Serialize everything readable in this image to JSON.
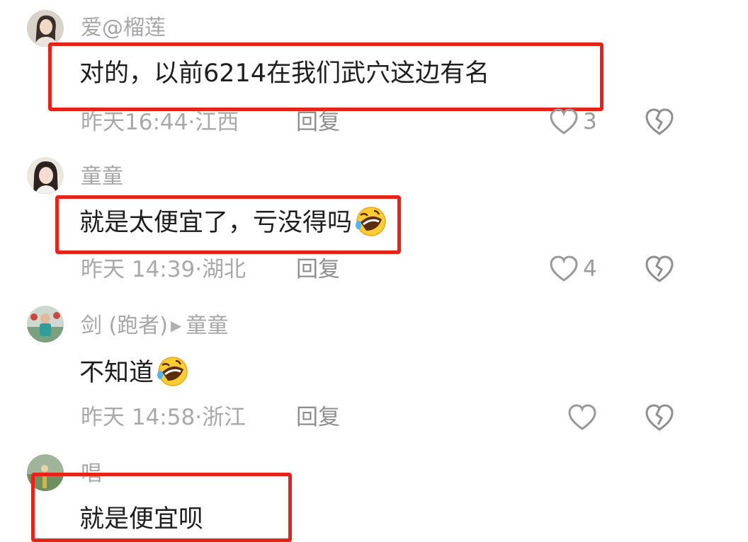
{
  "comments": [
    {
      "username": "爱@榴莲",
      "text": "对的，以前6214在我们武穴这边有名",
      "time": "昨天16:44",
      "location": "江西",
      "reply_label": "回复",
      "likes": "3",
      "avatar_icon": "user-avatar-photo"
    },
    {
      "username": "童童",
      "text": "就是太便宜了，亏没得吗",
      "emoji": "rolling-laughing-emoji",
      "time": "昨天 14:39",
      "location": "湖北",
      "reply_label": "回复",
      "likes": "4",
      "avatar_icon": "user-avatar-photo"
    },
    {
      "username": "剑 (跑者)",
      "reply_to": "童童",
      "text": "不知道",
      "emoji": "rolling-laughing-emoji",
      "time": "昨天 14:58",
      "location": "浙江",
      "reply_label": "回复",
      "likes": "",
      "avatar_icon": "user-avatar-photo"
    },
    {
      "username": "唱",
      "text": "就是便宜呗",
      "avatar_icon": "user-avatar-photo"
    }
  ],
  "separator": "·",
  "colors": {
    "highlight": "#e8211b",
    "meta_text": "#a9a9a9",
    "body_text": "#1e1e1e"
  }
}
